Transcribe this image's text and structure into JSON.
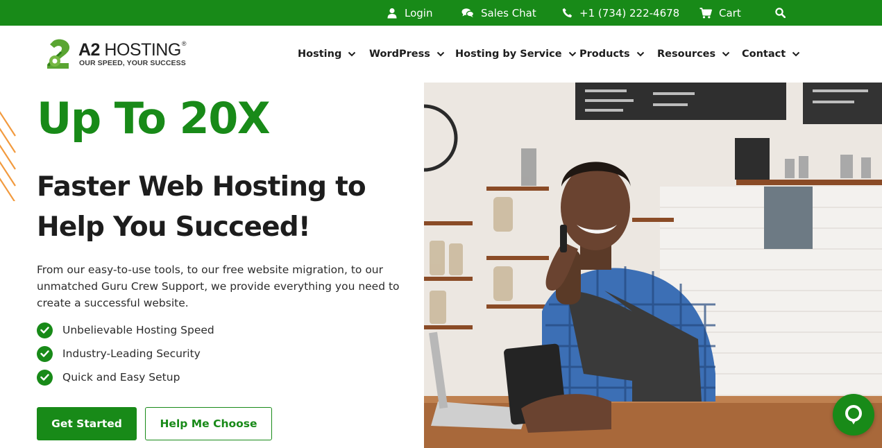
{
  "topbar": {
    "login": "Login",
    "sales_chat": "Sales Chat",
    "phone": "+1 (734) 222-4678",
    "cart": "Cart"
  },
  "logo": {
    "name_bold": "A2",
    "name_rest": " HOSTING",
    "registered": "®",
    "tagline": "OUR SPEED, YOUR SUCCESS"
  },
  "nav": {
    "items": [
      {
        "label": "Hosting"
      },
      {
        "label": "WordPress"
      },
      {
        "label": "Hosting by Service"
      },
      {
        "label": "Products"
      },
      {
        "label": "Resources"
      },
      {
        "label": "Contact"
      }
    ]
  },
  "hero": {
    "headline": "Up To 20X",
    "subheadline": "Faster Web Hosting to Help You Succeed!",
    "description": "From our easy-to-use tools, to our free website migration, to our unmatched Guru Crew Support, we provide everything you need to create a successful website.",
    "features": [
      {
        "label": "Unbelievable Hosting Speed"
      },
      {
        "label": "Industry-Leading Security"
      },
      {
        "label": "Quick and Easy Setup"
      }
    ],
    "primary_button": "Get Started",
    "secondary_button": "Help Me Choose"
  },
  "colors": {
    "brand_green": "#188a18",
    "accent_orange": "#f29a3e",
    "text_dark": "#1d1d1d"
  },
  "icons": {
    "login": "user-icon",
    "chat": "chat-bubbles-icon",
    "phone": "phone-icon",
    "cart": "cart-icon",
    "search": "search-icon",
    "nav_dropdown": "chevron-down-icon",
    "feature": "check-circle-icon",
    "chat_widget": "chat-widget-icon"
  }
}
